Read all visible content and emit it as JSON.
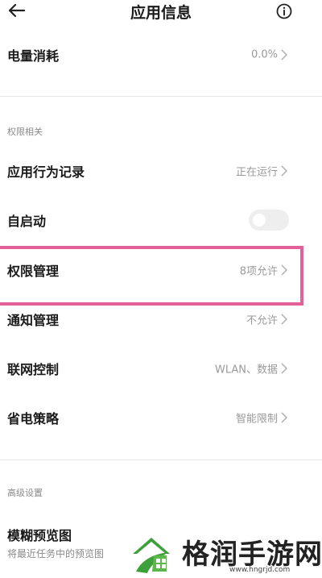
{
  "header": {
    "title": "应用信息",
    "back_icon": "arrow-left-icon",
    "info_icon": "info-icon"
  },
  "battery": {
    "label": "电量消耗",
    "value": "0.0%"
  },
  "permissions_section": {
    "title": "权限相关"
  },
  "rows": {
    "behavior": {
      "label": "应用行为记录",
      "value": "正在运行"
    },
    "autostart": {
      "label": "自启动",
      "toggle_on": false
    },
    "permission": {
      "label": "权限管理",
      "value": "8项允许"
    },
    "notification": {
      "label": "通知管理",
      "value": "不允许"
    },
    "network": {
      "label": "联网控制",
      "value": "WLAN、数据"
    },
    "power": {
      "label": "省电策略",
      "value": "智能限制"
    }
  },
  "advanced_section": {
    "title": "高级设置"
  },
  "blur_preview": {
    "label": "模糊预览图",
    "desc": "将最近任务中的预览图"
  },
  "watermark": {
    "text": "格润手游网",
    "url": "www.hngrjd.com"
  },
  "colors": {
    "highlight": "#e4609a",
    "watermark_green": "#3da03a"
  }
}
